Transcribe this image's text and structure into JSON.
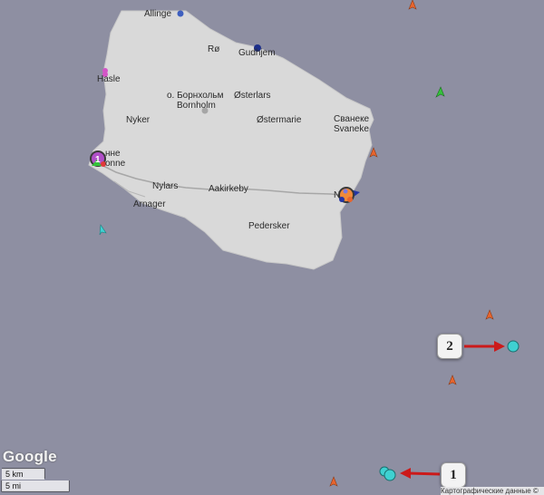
{
  "places": {
    "allinge": "Allinge",
    "ro": "Rø",
    "gudhjem": "Gudhjem",
    "hasle": "Hasle",
    "bornholm_ru": "о. Борнхольм",
    "bornholm": "Bornholm",
    "osterlars": "Østerlars",
    "nyker": "Nyker",
    "ostermarie": "Østermarie",
    "svaneke_ru": "Сванеке",
    "svaneke": "Svaneke",
    "ronne_ru": "нне",
    "ronne": "onne",
    "nylars": "Nylars",
    "aakirkeby": "Aakirkeby",
    "nexo": "N",
    "arnager": "Arnager",
    "pedersker": "Pedersker"
  },
  "markers": {
    "callout_1": "1",
    "callout_2": "2",
    "cluster_ronne": "1",
    "cluster_nexo": "N"
  },
  "map_ui": {
    "logo": "Google",
    "scale_km": "5 km",
    "scale_mi": "5 mi",
    "attribution": "Картографические данные ©"
  },
  "colors": {
    "sea": "#8e8fa2",
    "land": "#d9d9d9",
    "road": "#a9a9a9",
    "vessel_orange": "#e8652e",
    "vessel_green": "#35c23b",
    "vessel_cyan": "#3fd1d1",
    "vessel_blue": "#2a3a9e",
    "arrow_red": "#cc1a1a"
  }
}
